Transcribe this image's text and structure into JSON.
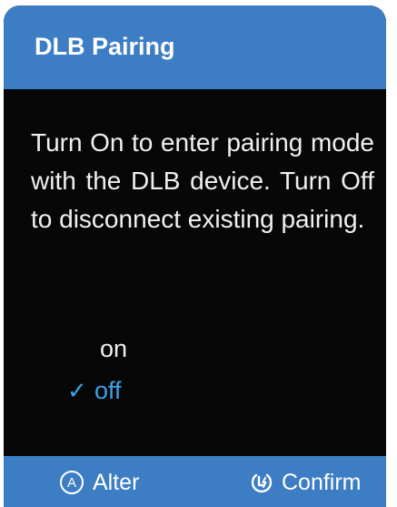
{
  "header": {
    "title": "DLB Pairing"
  },
  "description": {
    "text": "Turn On to enter pairing mode with the DLB device. Turn Off to disconnect existing pairing."
  },
  "options": {
    "on_label": "on",
    "off_label": "off",
    "selected": "off",
    "check_glyph": "✓"
  },
  "footer": {
    "alter_icon_letter": "A",
    "alter_label": "Alter",
    "confirm_label": "Confirm"
  },
  "colors": {
    "accent": "#3d7dc4",
    "selected": "#3ba2e8",
    "background": "#070707"
  },
  "icons": {
    "alter": "a-circle-icon",
    "confirm": "power-lightning-icon",
    "check": "check-icon"
  }
}
